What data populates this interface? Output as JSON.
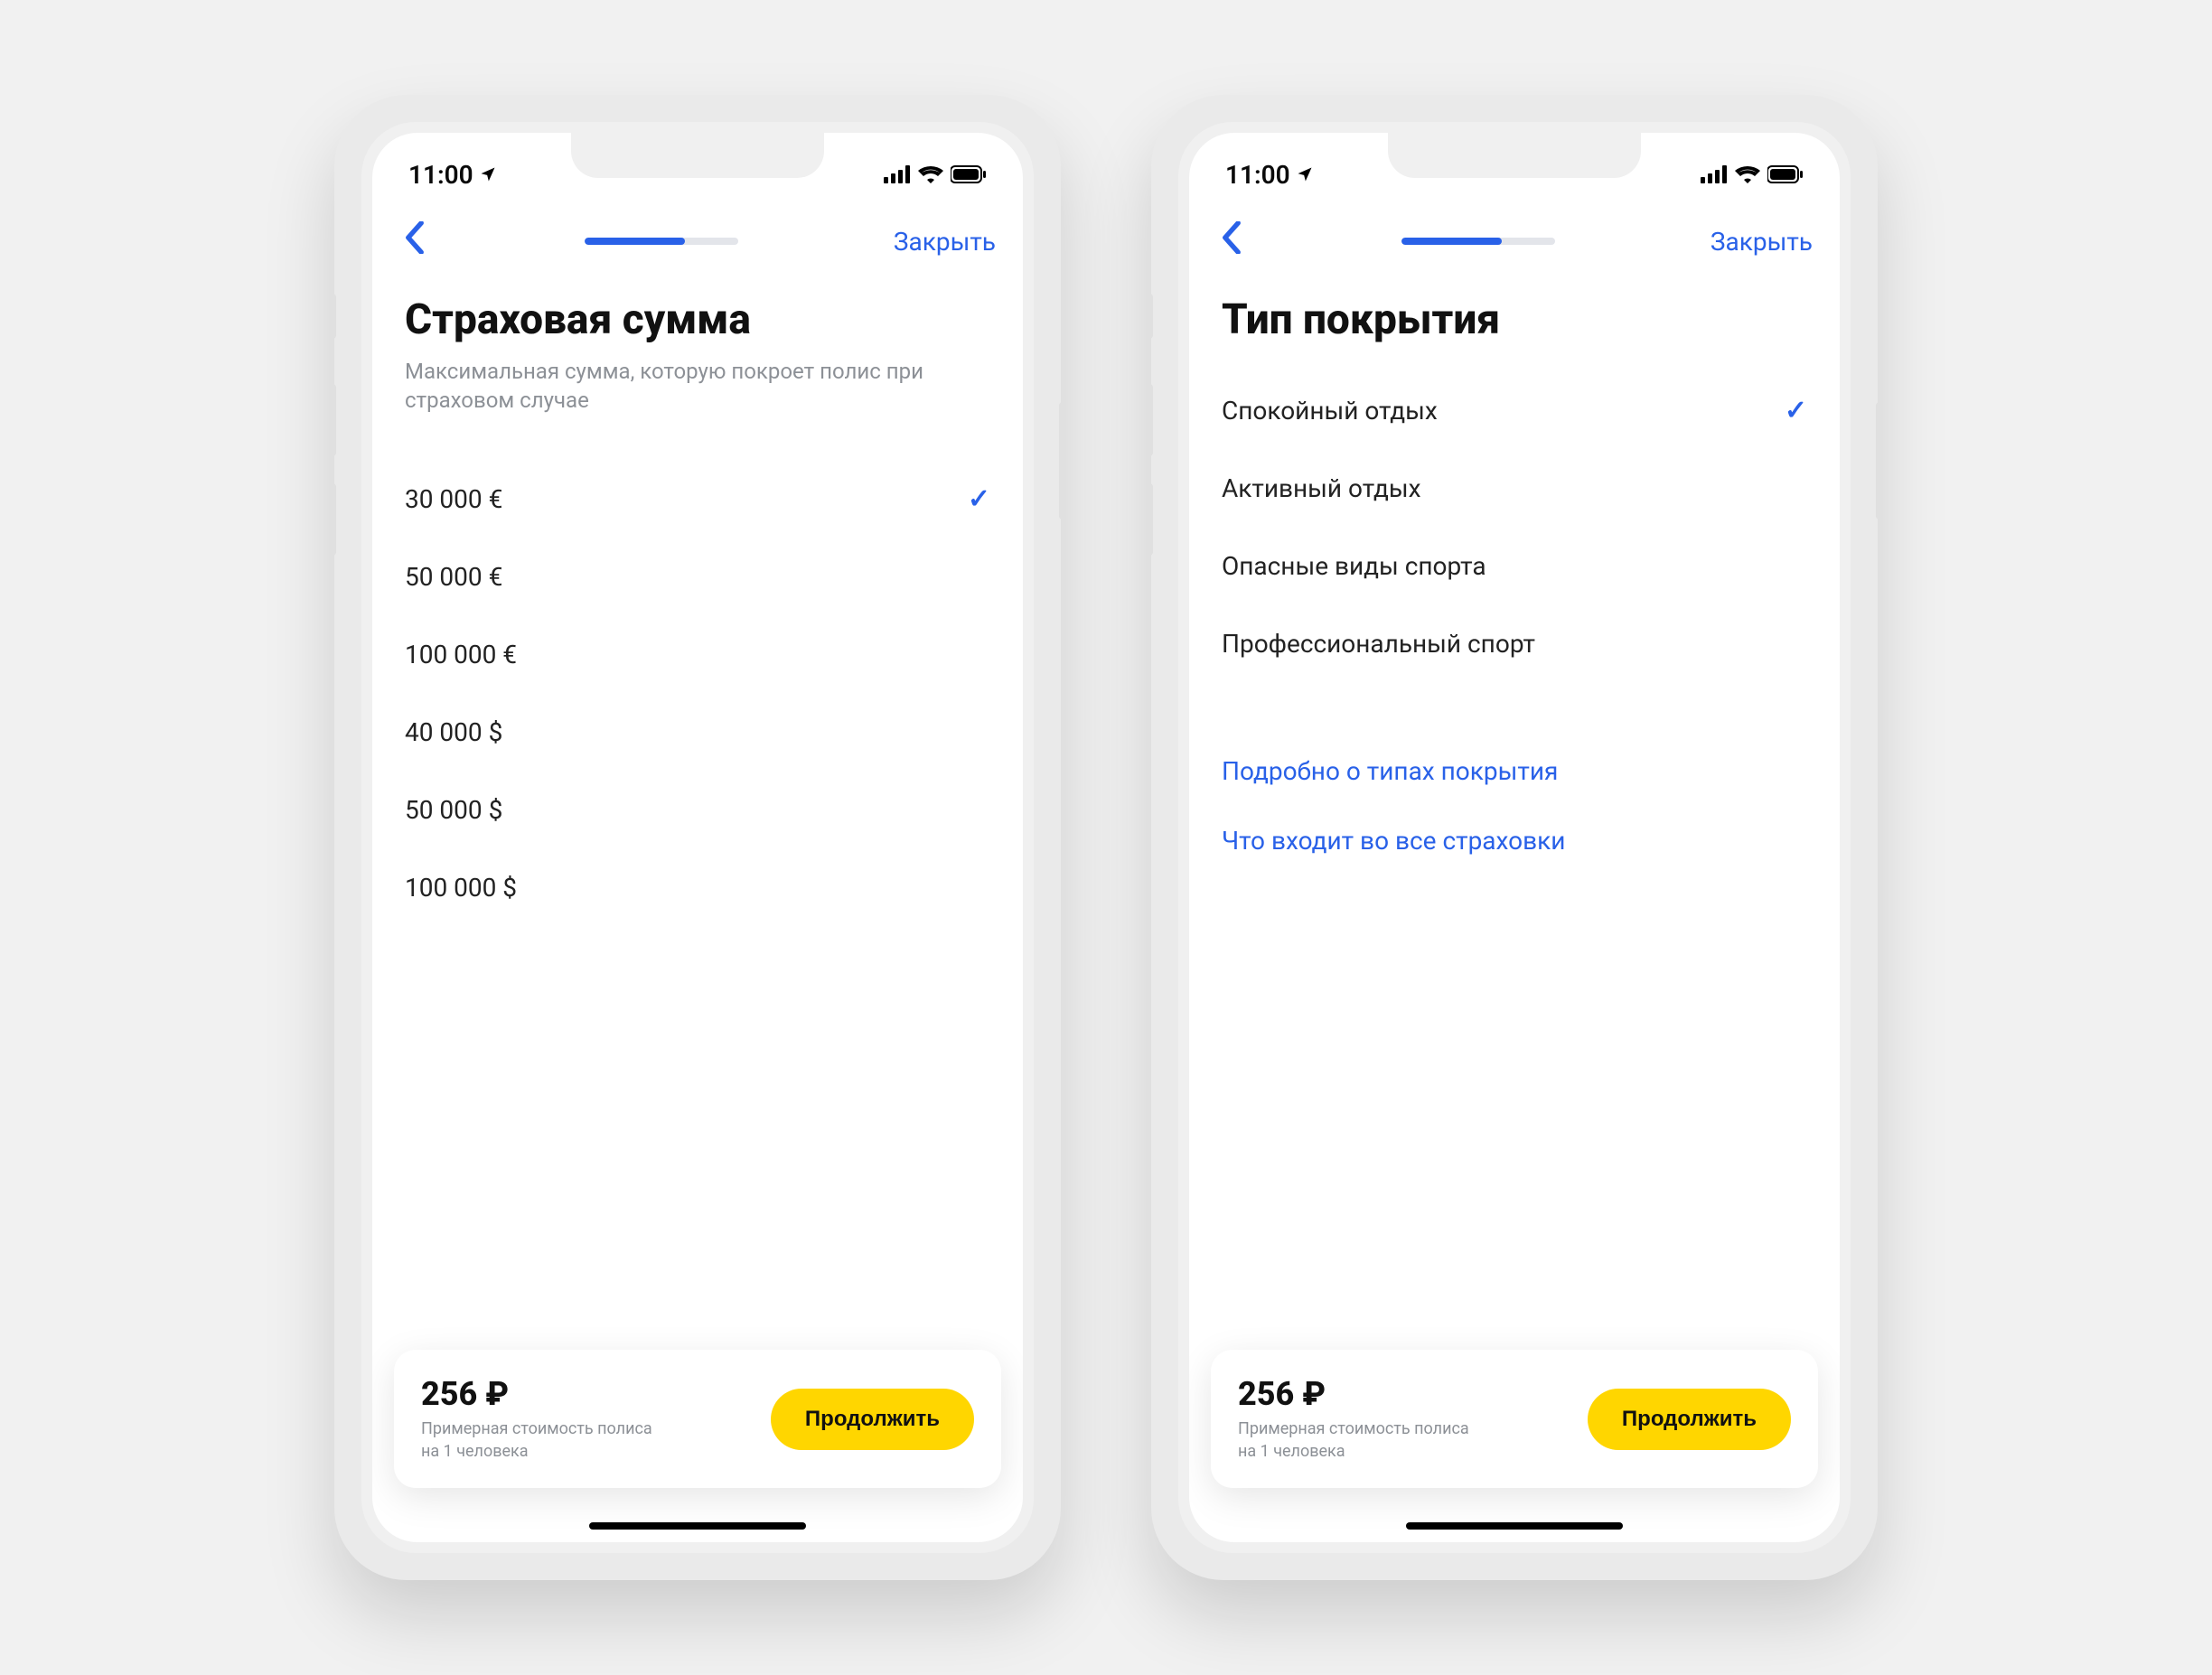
{
  "status": {
    "time": "11:00",
    "location_icon": "▸"
  },
  "nav": {
    "close": "Закрыть",
    "progress_pct": 65
  },
  "screen1": {
    "title": "Страховая сумма",
    "subtitle": "Максимальная сумма, которую покроет полис при страховом случае",
    "options": [
      {
        "label": "30 000 €",
        "selected": true
      },
      {
        "label": "50 000 €",
        "selected": false
      },
      {
        "label": "100 000 €",
        "selected": false
      },
      {
        "label": "40 000 $",
        "selected": false
      },
      {
        "label": "50 000 $",
        "selected": false
      },
      {
        "label": "100 000 $",
        "selected": false
      }
    ]
  },
  "screen2": {
    "title": "Тип покрытия",
    "options": [
      {
        "label": "Спокойный отдых",
        "selected": true
      },
      {
        "label": "Активный отдых",
        "selected": false
      },
      {
        "label": "Опасные виды спорта",
        "selected": false
      },
      {
        "label": "Профессиональный спорт",
        "selected": false
      }
    ],
    "links": [
      "Подробно о типах покрытия",
      "Что входит во все страховки"
    ]
  },
  "footer": {
    "price": "256 ₽",
    "caption_line1": "Примерная стоимость полиса",
    "caption_line2": "на 1 человека",
    "cta": "Продолжить"
  }
}
